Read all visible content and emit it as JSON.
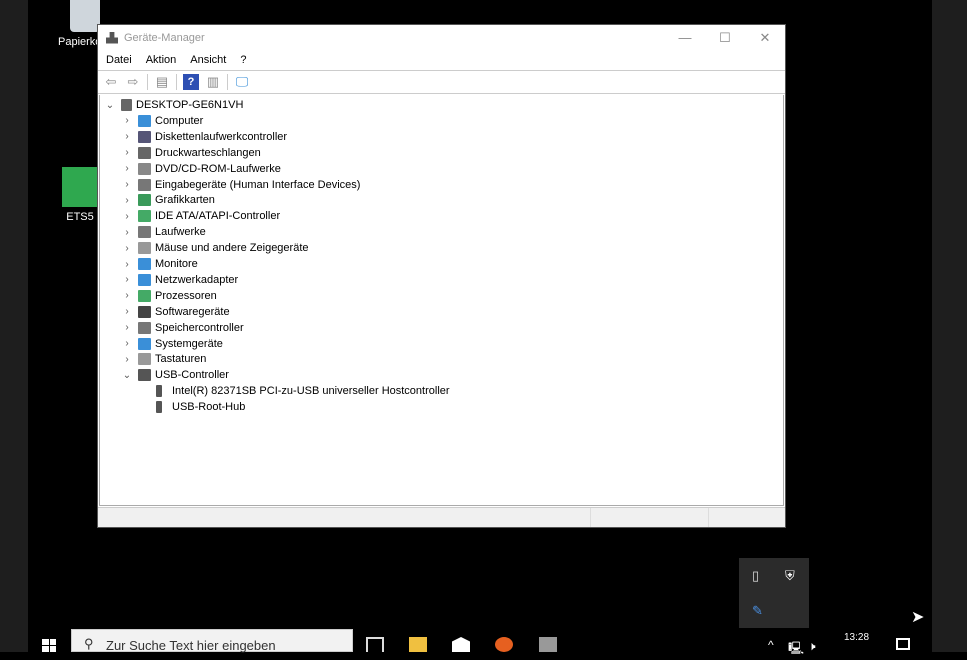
{
  "desktop": {
    "icons": [
      {
        "label": "Papierkorb"
      },
      {
        "label": "ETS5"
      }
    ]
  },
  "window": {
    "title": "Geräte-Manager",
    "menu": [
      "Datei",
      "Aktion",
      "Ansicht",
      "?"
    ],
    "tree": {
      "root": "DESKTOP-GE6N1VH",
      "categories": [
        {
          "label": "Computer",
          "color": "#3a8fd8"
        },
        {
          "label": "Diskettenlaufwerkcontroller",
          "color": "#557"
        },
        {
          "label": "Druckwarteschlangen",
          "color": "#666"
        },
        {
          "label": "DVD/CD-ROM-Laufwerke",
          "color": "#888"
        },
        {
          "label": "Eingabegeräte (Human Interface Devices)",
          "color": "#777"
        },
        {
          "label": "Grafikkarten",
          "color": "#3a9a5a"
        },
        {
          "label": "IDE ATA/ATAPI-Controller",
          "color": "#4a6"
        },
        {
          "label": "Laufwerke",
          "color": "#777"
        },
        {
          "label": "Mäuse und andere Zeigegeräte",
          "color": "#999"
        },
        {
          "label": "Monitore",
          "color": "#3a8fd8"
        },
        {
          "label": "Netzwerkadapter",
          "color": "#3a8fd8"
        },
        {
          "label": "Prozessoren",
          "color": "#4a6"
        },
        {
          "label": "Softwaregeräte",
          "color": "#444"
        },
        {
          "label": "Speichercontroller",
          "color": "#777"
        },
        {
          "label": "Systemgeräte",
          "color": "#3a8fd8"
        },
        {
          "label": "Tastaturen",
          "color": "#999"
        },
        {
          "label": "USB-Controller",
          "color": "#555",
          "expanded": true
        }
      ],
      "usb_children": [
        "Intel(R) 82371SB PCI-zu-USB universeller Hostcontroller",
        "USB-Root-Hub"
      ]
    }
  },
  "taskbar": {
    "search_placeholder": "Zur Suche Text hier eingeben",
    "time": "13:28"
  }
}
